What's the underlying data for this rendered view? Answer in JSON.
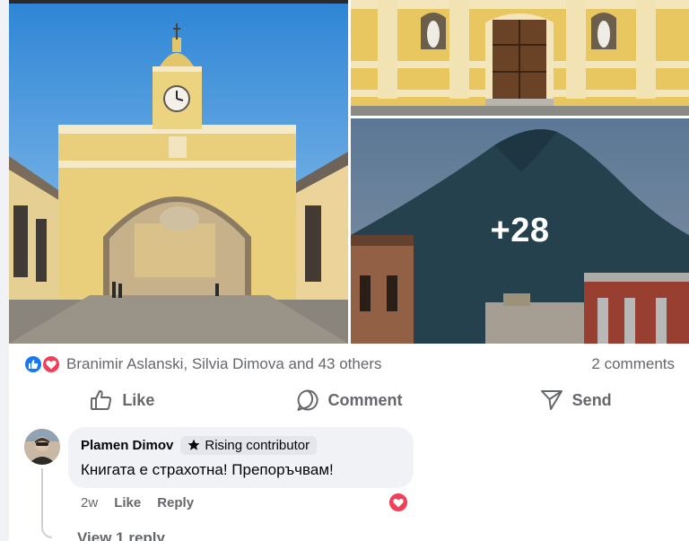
{
  "post": {
    "more_photos_label": "+28"
  },
  "reactions": {
    "names": "Branimir Aslanski, Silvia Dimova and 43 others",
    "comments_count": "2 comments"
  },
  "actions": {
    "like": "Like",
    "comment": "Comment",
    "send": "Send"
  },
  "comment": {
    "author": "Plamen Dimov",
    "badge": "Rising contributor",
    "text": "Книгата е страхотна! Препоръчвам!",
    "time": "2w",
    "like": "Like",
    "reply": "Reply",
    "view_replies": "View 1 reply"
  },
  "colors": {
    "like_blue": "#1877f2",
    "love_red": "#f33e58",
    "secondary_text": "#65676b",
    "bubble_bg": "#f0f2f5"
  }
}
